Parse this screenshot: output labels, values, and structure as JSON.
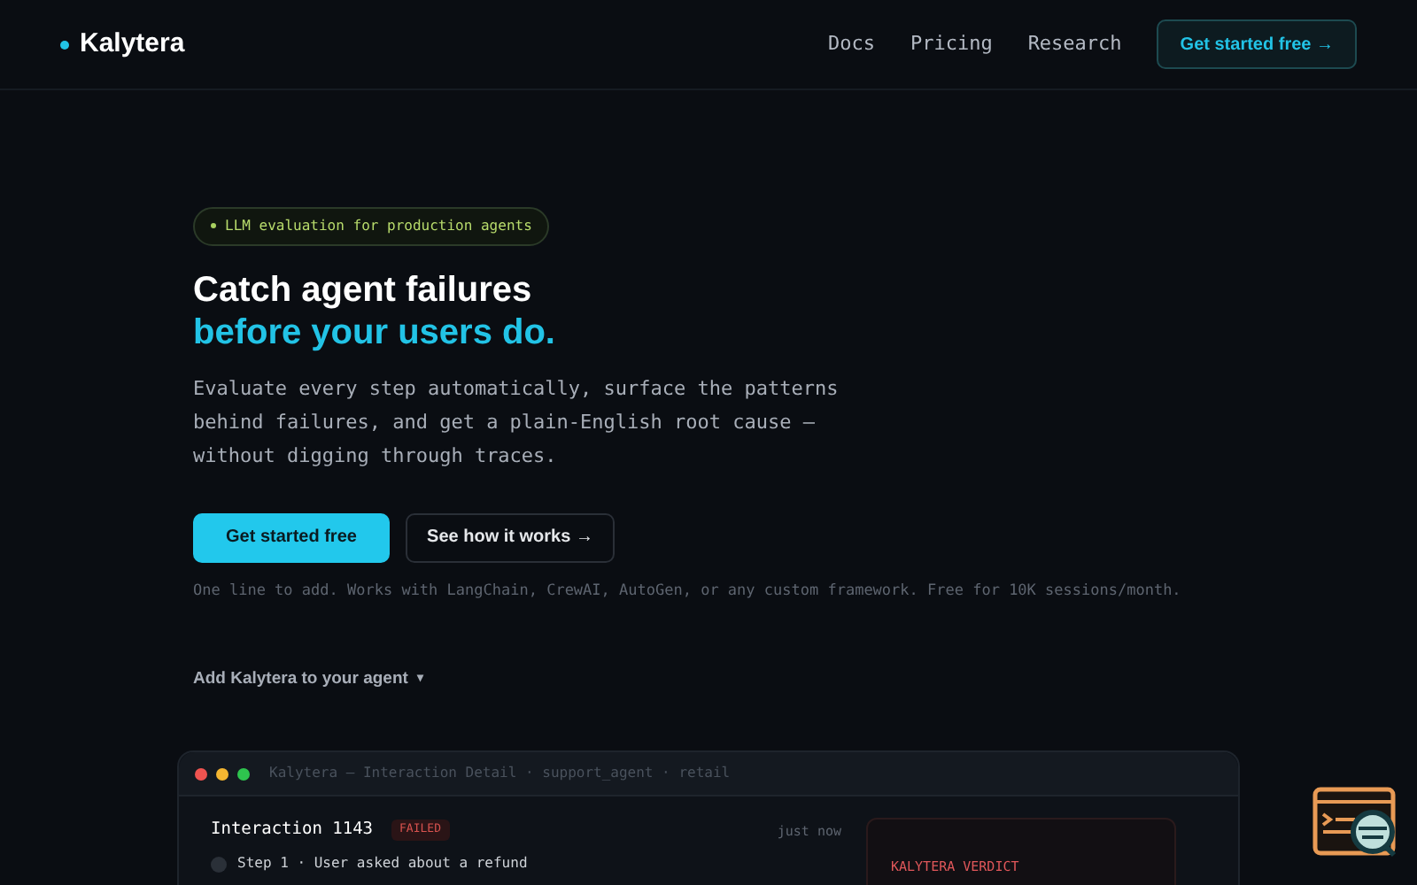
{
  "nav": {
    "logo": "Kalytera",
    "links": [
      "Docs",
      "Pricing",
      "Research"
    ],
    "cta": "Get started free →"
  },
  "hero": {
    "badge": "LLM evaluation for production agents",
    "title_line_1": "Catch agent failures",
    "title_line_2": "before your users do.",
    "lead": "Evaluate every step automatically, surface the patterns behind failures, and get a plain-English root cause — without digging through traces.",
    "primary_button": "Get started free",
    "secondary_button": "See how it works →",
    "note": "One line to add. Works with LangChain, CrewAI, AutoGen, or any custom framework. Free for 10K sessions/month.",
    "dropdown": {
      "label": "Add Kalytera to your agent",
      "caret": "▾",
      "expanded": false
    }
  },
  "preview": {
    "title": "Kalytera — Interaction Detail · support_agent · retail",
    "interaction": "Interaction 1143",
    "status": "FAILED",
    "time": "just now",
    "step": "Step 1 · User asked about a refund",
    "verdict_title": "KALYTERA VERDICT"
  }
}
